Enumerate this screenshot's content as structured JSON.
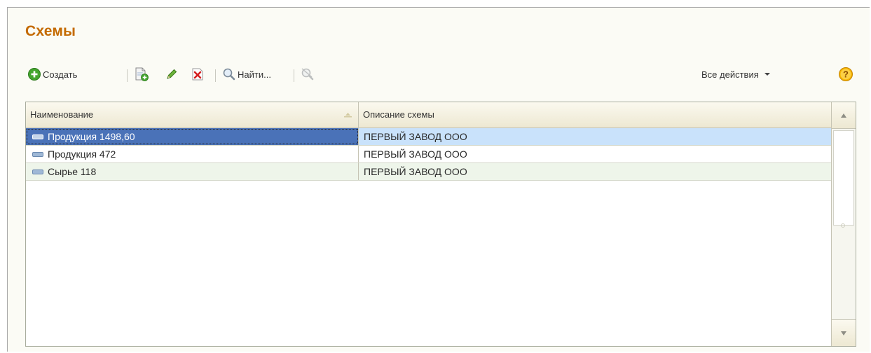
{
  "form": {
    "title": "Схемы"
  },
  "toolbar": {
    "create_label": "Создать",
    "find_label": "Найти...",
    "all_actions_label": "Все действия"
  },
  "table": {
    "columns": [
      "Наименование",
      "Описание схемы"
    ],
    "rows": [
      {
        "name": "Продукция 1498,60",
        "description": "ПЕРВЫЙ ЗАВОД ООО",
        "selected": true
      },
      {
        "name": "Продукция 472",
        "description": "ПЕРВЫЙ ЗАВОД ООО",
        "selected": false
      },
      {
        "name": "Сырье 118",
        "description": "ПЕРВЫЙ ЗАВОД ООО",
        "selected": false
      }
    ]
  },
  "icons": {
    "create": "add-circle-icon",
    "copy": "copy-document-icon",
    "edit": "pencil-icon",
    "delete": "delete-icon",
    "find": "magnifier-icon",
    "cancel_search": "cancel-search-icon",
    "dropdown": "triangle-down-icon",
    "help": "help-icon",
    "row_item": "dash-item-icon",
    "sort": "sort-indicator-icon",
    "scroll_up": "scroll-up-icon",
    "scroll_down": "scroll-down-icon"
  },
  "colors": {
    "title": "#c46a00",
    "selected_cell": "#4a72b8",
    "selected_row": "#c9e2fb",
    "alt_row": "#eef5ea",
    "create_icon": "#3c9a2a",
    "delete_icon": "#d42020",
    "help_icon": "#f0a400"
  }
}
